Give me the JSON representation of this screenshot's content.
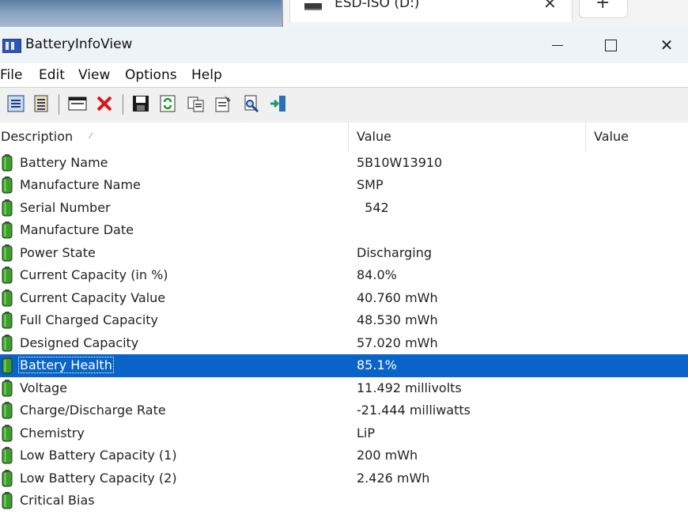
{
  "background_tab": {
    "title": "ESD-ISO (D:)",
    "close_glyph": "✕",
    "new_tab_glyph": "+"
  },
  "window": {
    "title": "BatteryInfoView",
    "minimize_icon": "minimize-icon",
    "maximize_icon": "maximize-icon",
    "close_glyph": "✕"
  },
  "menu": [
    "File",
    "Edit",
    "View",
    "Options",
    "Help"
  ],
  "toolbar": {
    "icons": [
      "html-report-icon",
      "properties-list-icon",
      "window-icon",
      "delete-icon",
      "save-icon",
      "refresh-icon",
      "copy-icon",
      "properties-icon",
      "find-icon",
      "exit-icon"
    ]
  },
  "columns": [
    "Description",
    "Value",
    "Value"
  ],
  "rows": [
    {
      "label": "Battery Name",
      "value": "5B10W13910"
    },
    {
      "label": "Manufacture Name",
      "value": "SMP"
    },
    {
      "label": "Serial Number",
      "value": "  542"
    },
    {
      "label": "Manufacture Date",
      "value": ""
    },
    {
      "label": "Power State",
      "value": "Discharging"
    },
    {
      "label": "Current Capacity (in %)",
      "value": "84.0%"
    },
    {
      "label": "Current Capacity Value",
      "value": "40.760 mWh"
    },
    {
      "label": "Full Charged Capacity",
      "value": "48.530 mWh"
    },
    {
      "label": "Designed Capacity",
      "value": "57.020 mWh"
    },
    {
      "label": "Battery Health",
      "value": "85.1%",
      "selected": true
    },
    {
      "label": "Voltage",
      "value": "11.492 millivolts"
    },
    {
      "label": "Charge/Discharge Rate",
      "value": "-21.444 milliwatts"
    },
    {
      "label": "Chemistry",
      "value": "LiP"
    },
    {
      "label": "Low Battery Capacity (1)",
      "value": "200 mWh"
    },
    {
      "label": "Low Battery Capacity (2)",
      "value": "2.426 mWh"
    },
    {
      "label": "Critical Bias",
      "value": ""
    }
  ],
  "colors": {
    "selection": "#0a64c8",
    "battery_green": "#3aa02a",
    "titlebar": "#eef3f8"
  }
}
